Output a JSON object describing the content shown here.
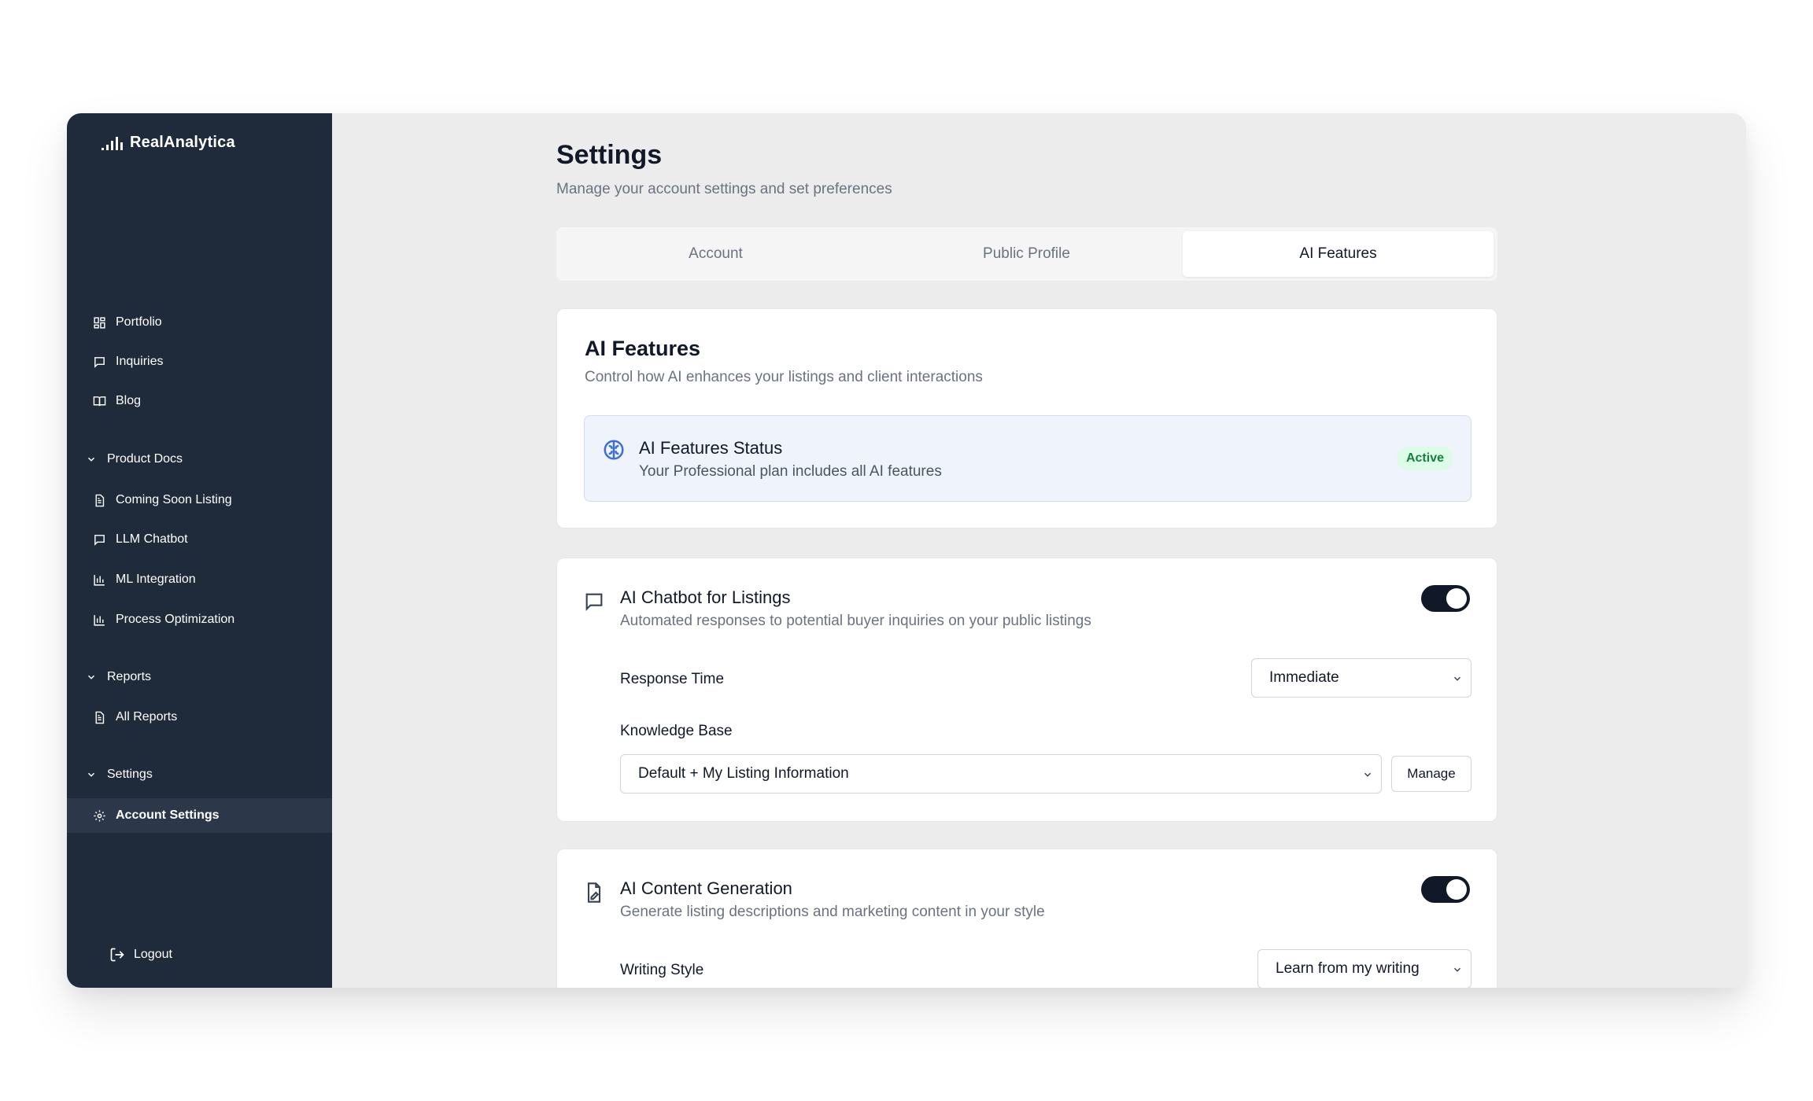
{
  "brand": {
    "name": "RealAnalytica"
  },
  "sidebar": {
    "items": [
      {
        "label": "Portfolio",
        "icon": "grid-icon"
      },
      {
        "label": "Inquiries",
        "icon": "message-icon"
      },
      {
        "label": "Blog",
        "icon": "book-icon"
      }
    ],
    "sections": [
      {
        "label": "Product Docs",
        "items": [
          {
            "label": "Coming Soon Listing",
            "icon": "document-icon"
          },
          {
            "label": "LLM Chatbot",
            "icon": "message-icon"
          },
          {
            "label": "ML Integration",
            "icon": "bar-chart-icon"
          },
          {
            "label": "Process Optimization",
            "icon": "bar-chart-icon"
          }
        ]
      },
      {
        "label": "Reports",
        "items": [
          {
            "label": "All Reports",
            "icon": "document-icon"
          }
        ]
      },
      {
        "label": "Settings",
        "items": [
          {
            "label": "Account Settings",
            "icon": "gear-icon",
            "active": true
          }
        ]
      }
    ],
    "logout": "Logout"
  },
  "page": {
    "title": "Settings",
    "subtitle": "Manage your account settings and set preferences"
  },
  "tabs": [
    {
      "label": "Account"
    },
    {
      "label": "Public Profile"
    },
    {
      "label": "AI Features",
      "active": true
    }
  ],
  "ai_card": {
    "title": "AI Features",
    "description": "Control how AI enhances your listings and client interactions",
    "status": {
      "title": "AI Features Status",
      "description": "Your Professional plan includes all AI features",
      "badge": "Active"
    }
  },
  "chatbot": {
    "title": "AI Chatbot for Listings",
    "description": "Automated responses to potential buyer inquiries on your public listings",
    "enabled": true,
    "response_time_label": "Response Time",
    "response_time_value": "Immediate",
    "knowledge_base_label": "Knowledge Base",
    "knowledge_base_value": "Default + My Listing Information",
    "manage_label": "Manage"
  },
  "content_gen": {
    "title": "AI Content Generation",
    "description": "Generate listing descriptions and marketing content in your style",
    "enabled": true,
    "writing_style_label": "Writing Style",
    "writing_style_value": "Learn from my writing"
  },
  "colors": {
    "sidebar_bg": "#1f2a3b",
    "sidebar_active": "#2c3749",
    "main_bg": "#ececec",
    "status_bg": "#eef3fc",
    "badge_bg": "#dcfce7",
    "badge_text": "#15803d",
    "toggle_on": "#111827",
    "icon_blue": "#3b6fd6"
  }
}
